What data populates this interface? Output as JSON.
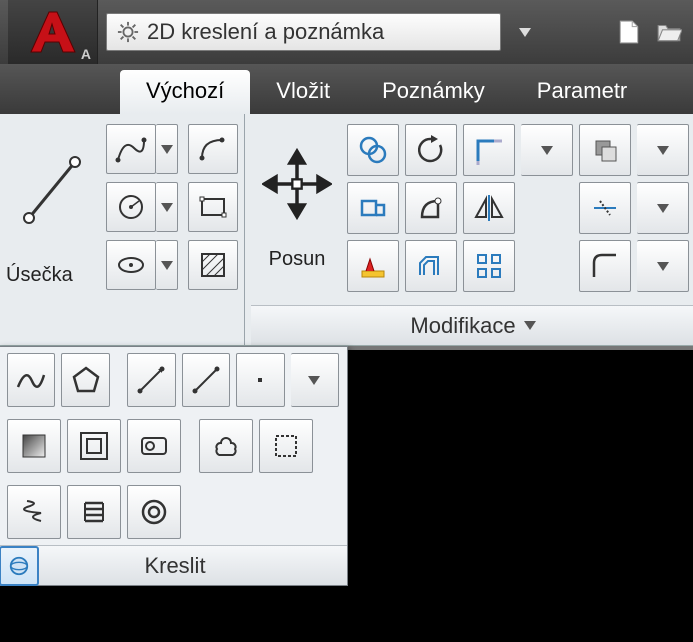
{
  "workspace": {
    "label": "2D kreslení a poznámka"
  },
  "tabs": [
    {
      "label": "Výchozí",
      "active": true
    },
    {
      "label": "Vložit"
    },
    {
      "label": "Poznámky"
    },
    {
      "label": "Parametr"
    }
  ],
  "panels": {
    "draw": {
      "big_label": "Úsečka"
    },
    "modify": {
      "big_label": "Posun",
      "footer_label": "Modifikace"
    }
  },
  "flyout": {
    "title": "Kreslit"
  }
}
